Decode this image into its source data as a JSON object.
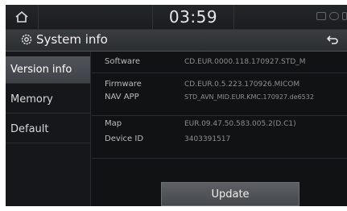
{
  "status": {
    "time": "03:59"
  },
  "header": {
    "title": "System info"
  },
  "sidebar": {
    "items": [
      {
        "label": "Version info"
      },
      {
        "label": "Memory"
      },
      {
        "label": "Default"
      }
    ]
  },
  "info": [
    {
      "label": "Software",
      "value": "CD.EUR.0000.118.170927.STD_M"
    },
    {
      "label": "Firmware",
      "value": "CD.EUR.0.5.223.170926.MICOM"
    },
    {
      "label": "NAV APP",
      "value": "STD_AVN_MID.EUR.KMC.170927.de6532"
    },
    {
      "label": "Map",
      "value": "EUR.09.47.50.583.005.2(D.C1)"
    },
    {
      "label": "Device ID",
      "value": "3403391517"
    }
  ],
  "actions": {
    "update_label": "Update"
  }
}
